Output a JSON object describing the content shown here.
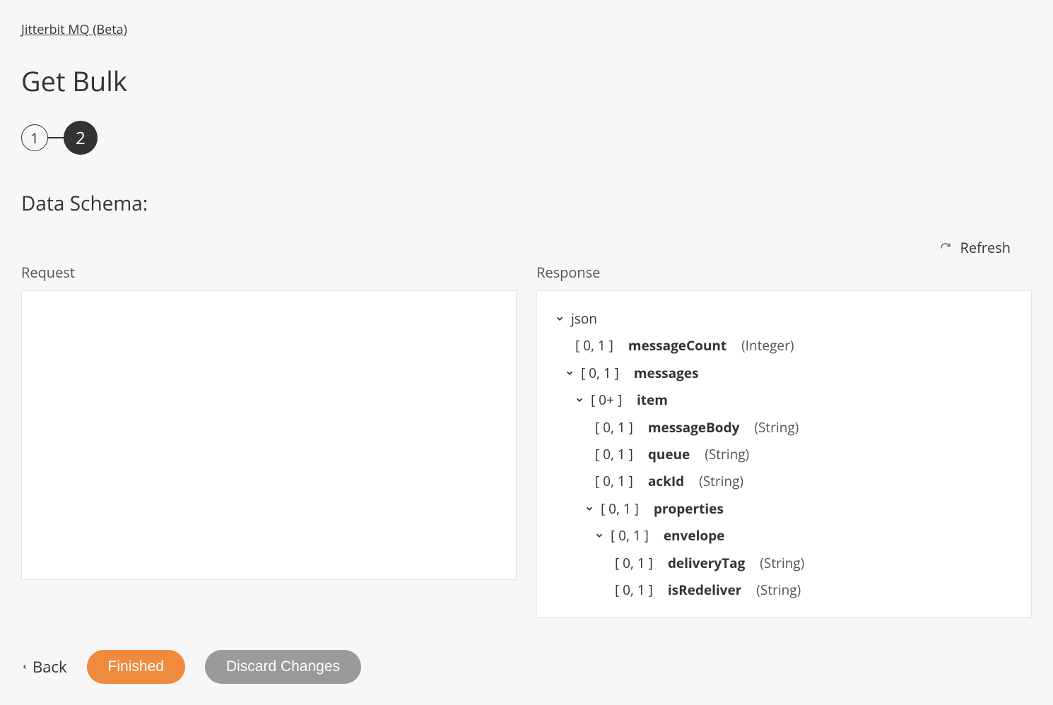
{
  "breadcrumb": "Jitterbit MQ (Beta)",
  "title": "Get Bulk",
  "steps": {
    "s1": "1",
    "s2": "2"
  },
  "section": "Data Schema:",
  "refresh": "Refresh",
  "requestLabel": "Request",
  "responseLabel": "Response",
  "tree": {
    "root": "json",
    "mc_card": "[ 0, 1 ]",
    "mc_name": "messageCount",
    "mc_type": "(Integer)",
    "msgs_card": "[ 0, 1 ]",
    "msgs_name": "messages",
    "item_card": "[ 0+ ]",
    "item_name": "item",
    "mb_card": "[ 0, 1 ]",
    "mb_name": "messageBody",
    "mb_type": "(String)",
    "q_card": "[ 0, 1 ]",
    "q_name": "queue",
    "q_type": "(String)",
    "ack_card": "[ 0, 1 ]",
    "ack_name": "ackId",
    "ack_type": "(String)",
    "props_card": "[ 0, 1 ]",
    "props_name": "properties",
    "env_card": "[ 0, 1 ]",
    "env_name": "envelope",
    "dt_card": "[ 0, 1 ]",
    "dt_name": "deliveryTag",
    "dt_type": "(String)",
    "ir_card": "[ 0, 1 ]",
    "ir_name": "isRedeliver",
    "ir_type": "(String)"
  },
  "footer": {
    "back": "Back",
    "finished": "Finished",
    "discard": "Discard Changes"
  }
}
